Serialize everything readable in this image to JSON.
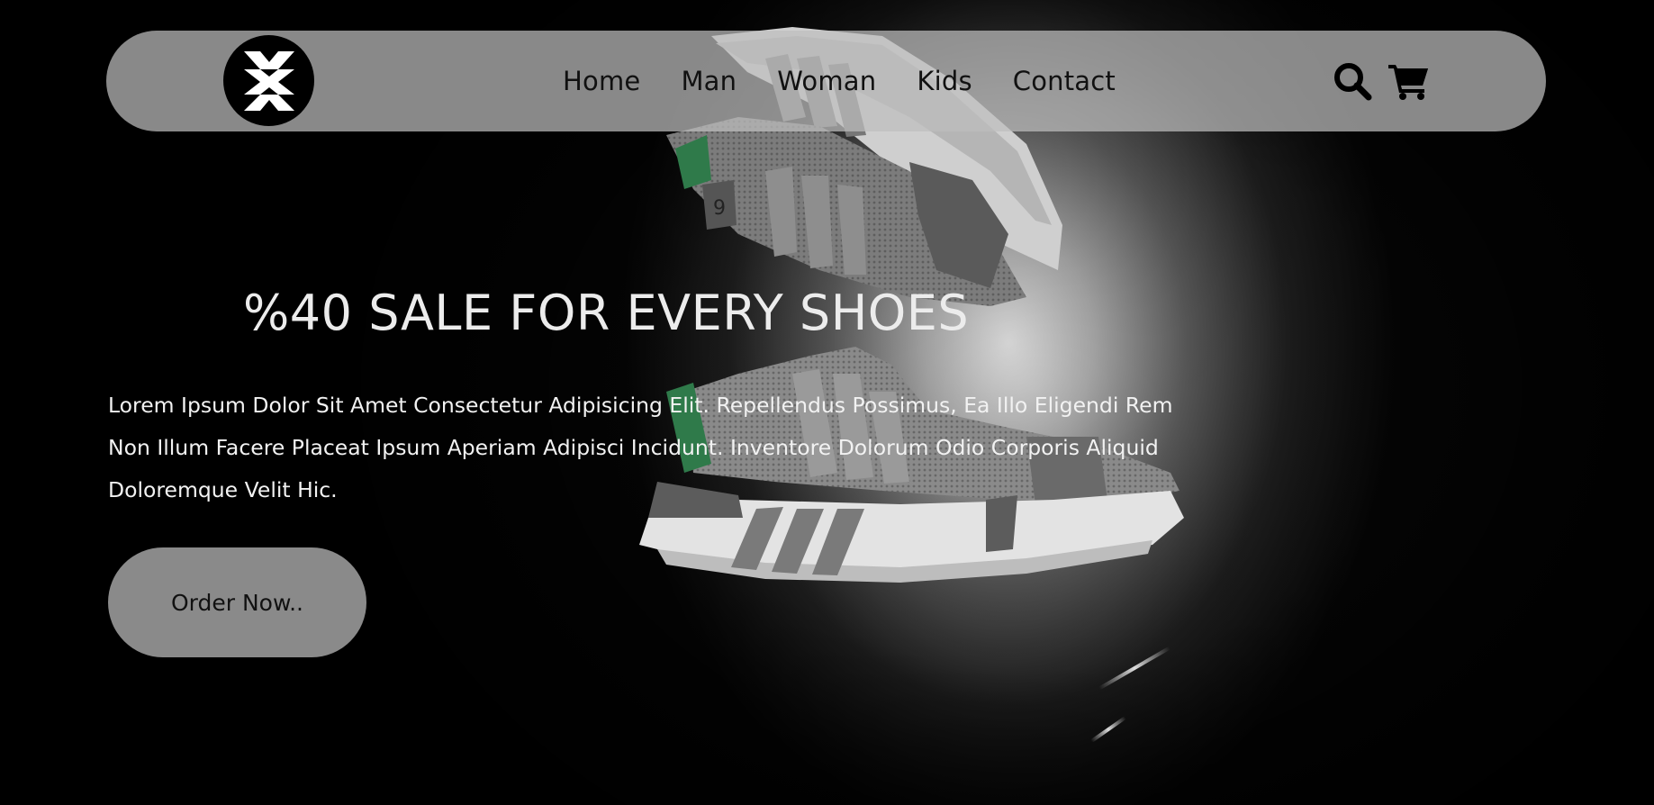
{
  "brand": {
    "logo_icon": "stylized-x-logo-icon"
  },
  "nav": {
    "links": [
      {
        "label": "Home"
      },
      {
        "label": "Man"
      },
      {
        "label": "Woman"
      },
      {
        "label": "Kids"
      },
      {
        "label": "Contact"
      }
    ],
    "icons": [
      {
        "name": "search-icon"
      },
      {
        "name": "cart-icon"
      }
    ]
  },
  "hero": {
    "headline": "%40 SALE FOR EVERY SHOES",
    "description": "Lorem Ipsum Dolor Sit Amet Consectetur Adipisicing Elit. Repellendus Possimus, Ea Illo Eligendi Rem Non Illum Facere Placeat Ipsum Aperiam Adipisci Incidunt. Inventore Dolorum Odio Corporis Aliquid Doloremque Velit Hic.",
    "cta_label": "Order Now..",
    "image": "sneakers-photo"
  },
  "colors": {
    "background": "#000000",
    "navbar": "#bebebe",
    "button": "#8a8a8a",
    "text_light": "#f2f2f2",
    "text_dark": "#111111"
  }
}
